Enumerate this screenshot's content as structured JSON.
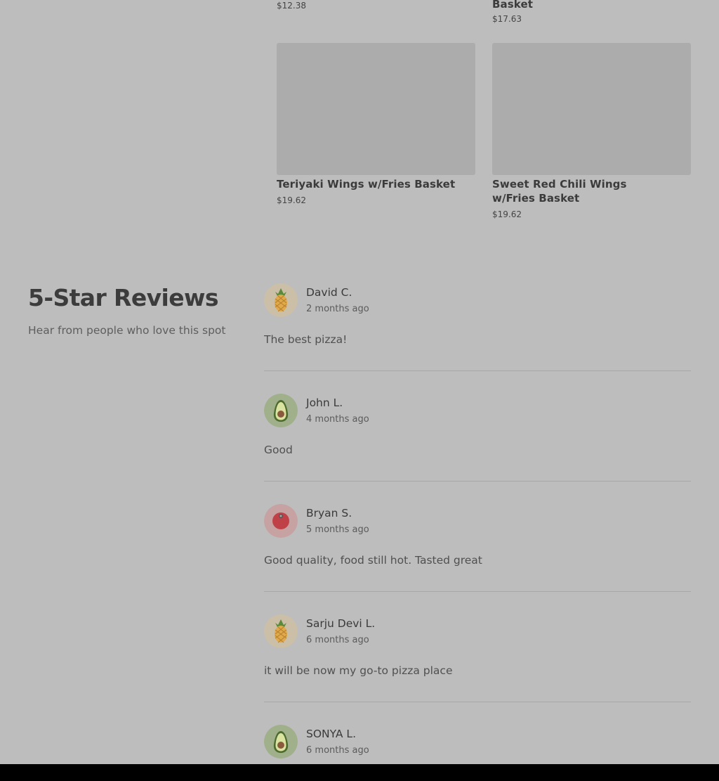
{
  "menu": {
    "items": [
      {
        "name": "",
        "price": "$12.38"
      },
      {
        "name": "Basket",
        "price": "$17.63"
      },
      {
        "name": "Teriyaki Wings w/Fries Basket",
        "price": "$19.62"
      },
      {
        "name": "Sweet Red Chili Wings  w/Fries Basket",
        "price": "$19.62"
      }
    ]
  },
  "reviews": {
    "title": "5-Star Reviews",
    "subtitle": "Hear from people who love this spot",
    "items": [
      {
        "name": "David C.",
        "date": "2 months ago",
        "text": "The best pizza!",
        "avatar_icon": "pineapple-icon"
      },
      {
        "name": "John L.",
        "date": "4 months ago",
        "text": "Good",
        "avatar_icon": "avocado-icon"
      },
      {
        "name": "Bryan S.",
        "date": "5 months ago",
        "text": "Good quality, food still hot. Tasted great",
        "avatar_icon": "tomato-icon"
      },
      {
        "name": "Sarju Devi L.",
        "date": "6 months ago",
        "text": "it will be now my go-to pizza place",
        "avatar_icon": "pineapple-icon"
      },
      {
        "name": "SONYA L.",
        "date": "6 months ago",
        "text": "",
        "avatar_icon": "avocado-icon"
      }
    ]
  },
  "colors": {
    "overlay_bg": "#bdbdbd",
    "pineapple_bg": "#cbbfa8",
    "avocado_bg": "#9fb08a",
    "tomato_bg": "#c6a2a2"
  }
}
